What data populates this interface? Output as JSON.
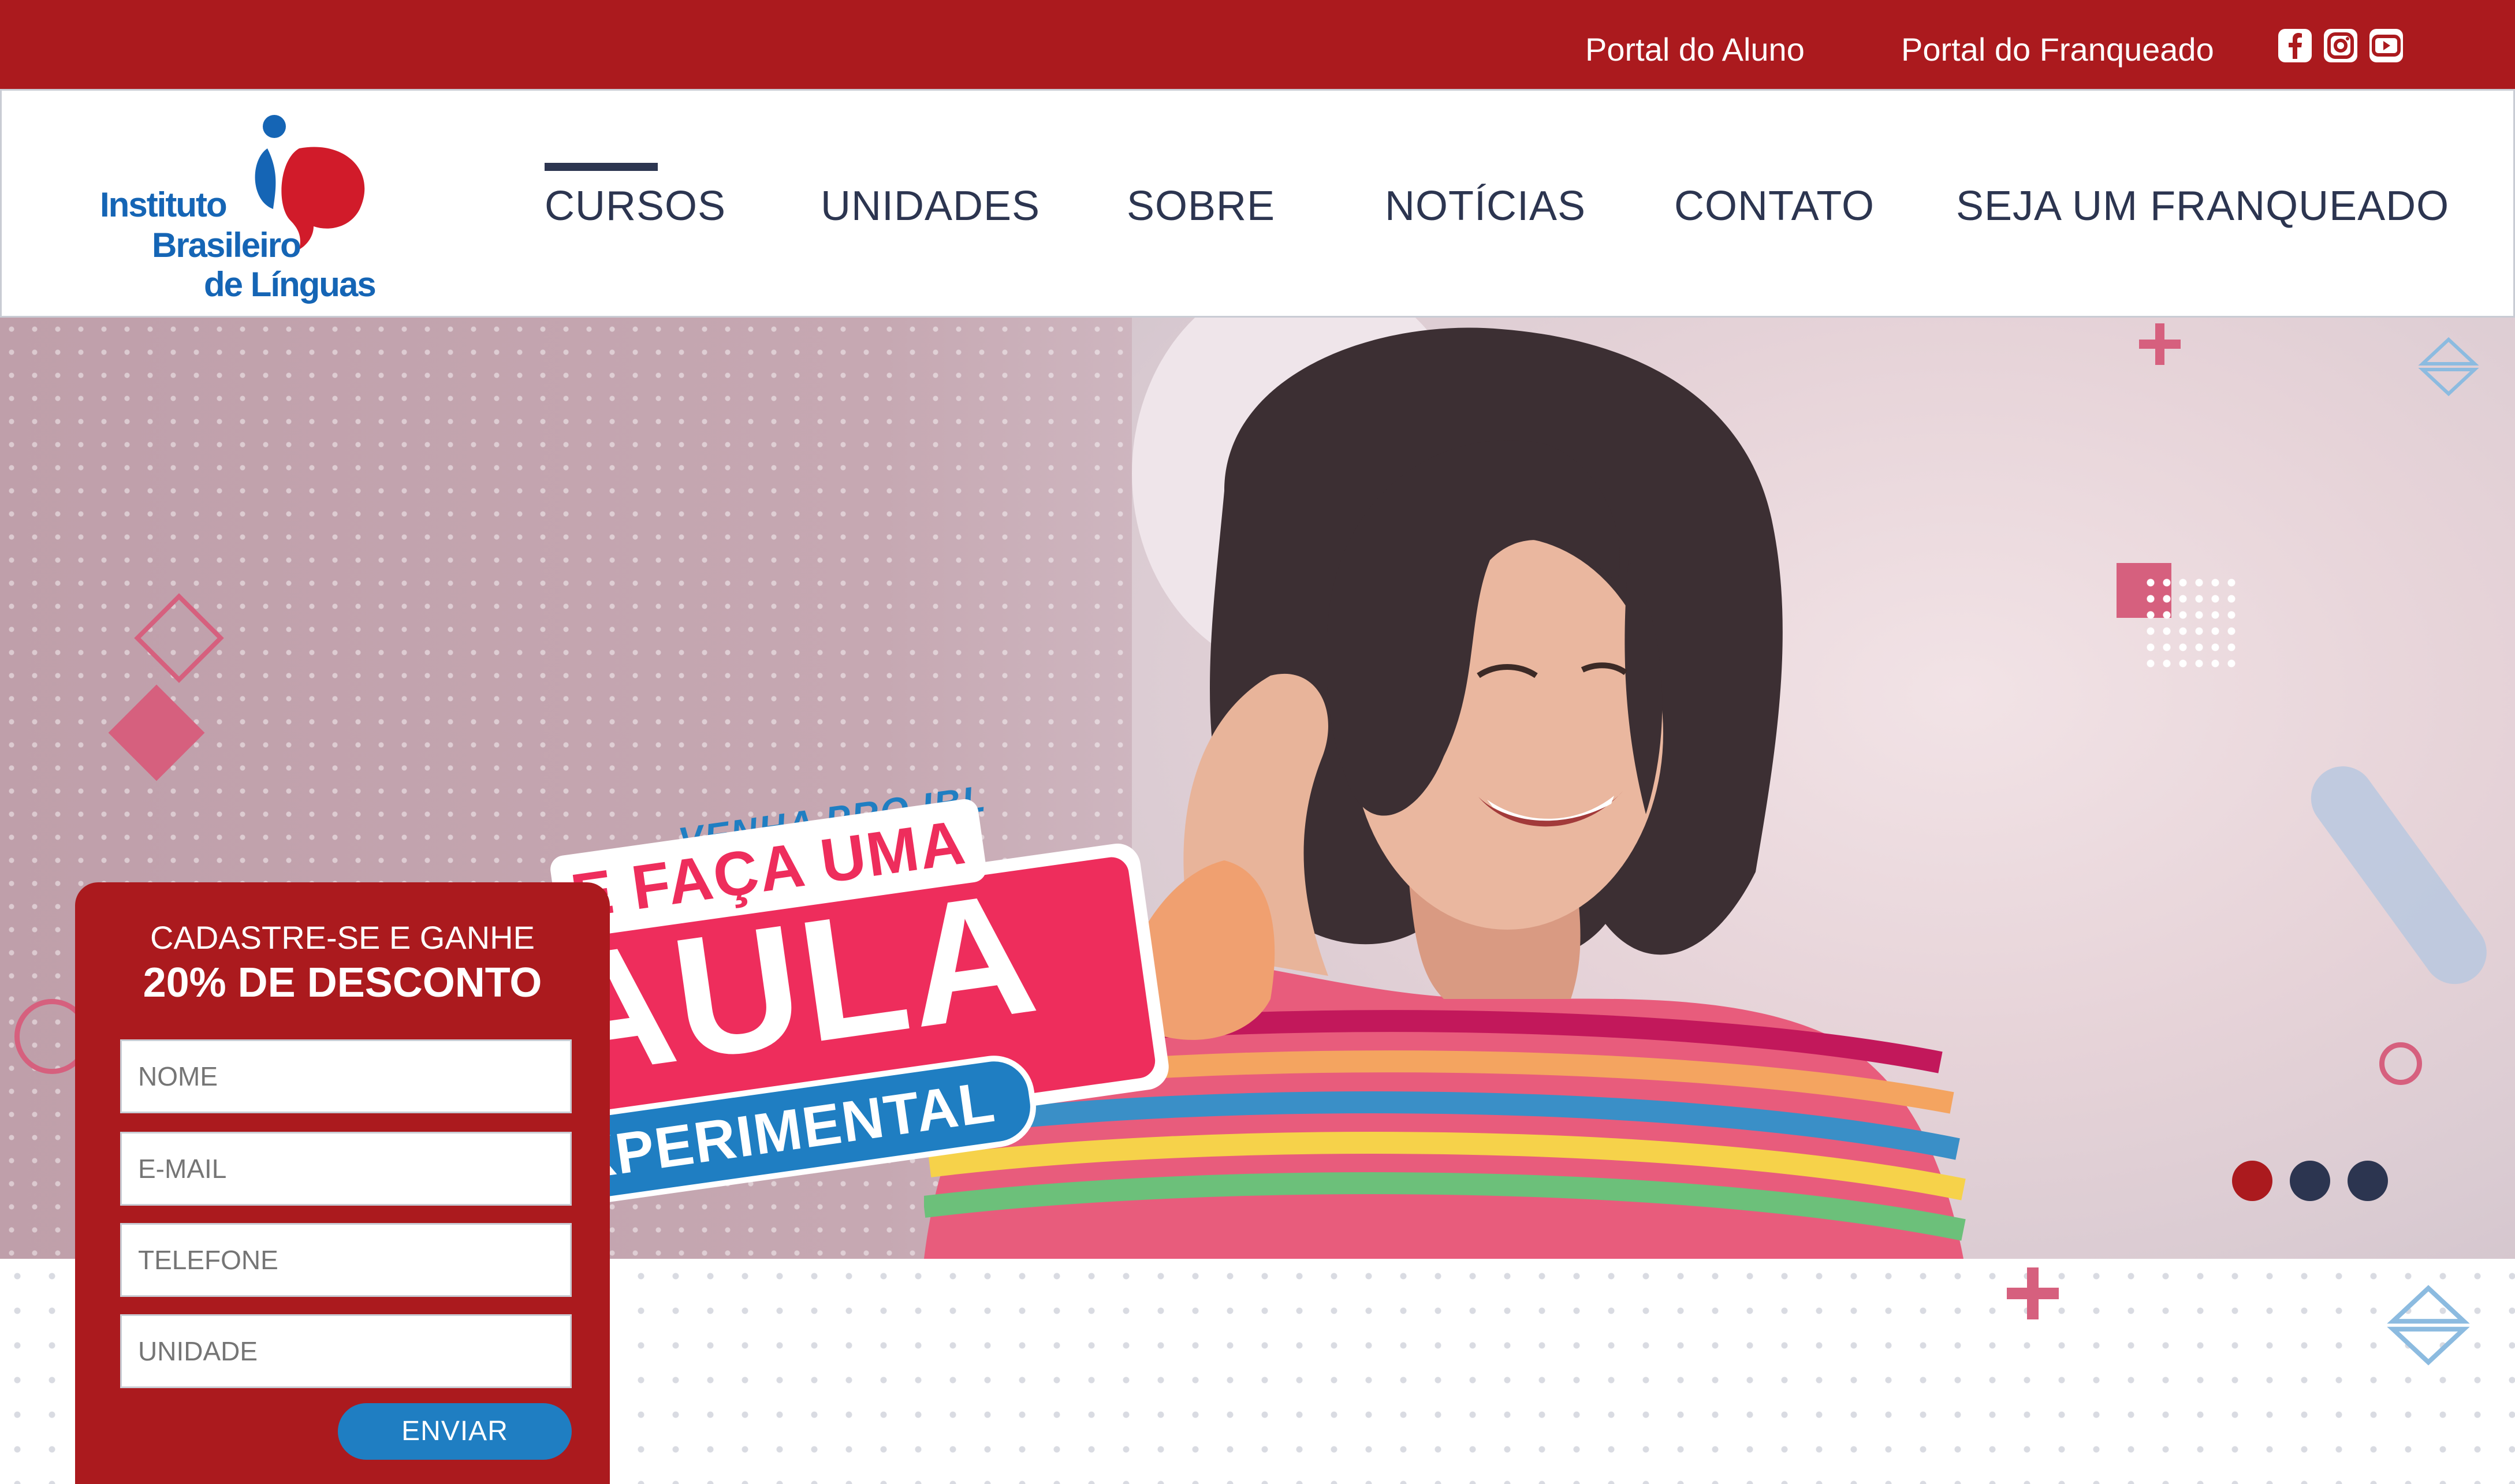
{
  "topbar": {
    "links": [
      {
        "label": "Portal do Aluno"
      },
      {
        "label": "Portal do Franqueado"
      }
    ],
    "social": [
      "facebook-icon",
      "instagram-icon",
      "youtube-icon"
    ],
    "color": "#ab1a1e"
  },
  "logo": {
    "line1": "Instituto",
    "line2": "Brasileiro",
    "line3": "de Línguas",
    "colors": {
      "blue": "#1565b5",
      "red": "#d11b2a"
    }
  },
  "nav": {
    "items": [
      {
        "label": "CURSOS",
        "active": true
      },
      {
        "label": "UNIDADES"
      },
      {
        "label": "SOBRE"
      },
      {
        "label": "NOTÍCIAS"
      },
      {
        "label": "CONTATO"
      },
      {
        "label": "SEJA UM FRANQUEADO"
      }
    ],
    "color": "#2c3550"
  },
  "hero": {
    "promo": {
      "line1": "VENHA PRO IBL",
      "line2": "E FAÇA UMA",
      "line3": "AULA",
      "line4": "EXPERIMENTAL"
    },
    "colors": {
      "pink": "#ee2d5c",
      "blue": "#1f7ec2"
    },
    "carousel": {
      "count": 3,
      "active": 0,
      "active_color": "#ab1a1e",
      "inactive_color": "#2c3550"
    }
  },
  "form": {
    "title1": "CADASTRE-SE E GANHE",
    "title2": "20% DE DESCONTO",
    "fields": [
      {
        "placeholder": "NOME"
      },
      {
        "placeholder": "E-MAIL"
      },
      {
        "placeholder": "TELEFONE"
      },
      {
        "placeholder": "UNIDADE"
      }
    ],
    "submit": "ENVIAR"
  }
}
